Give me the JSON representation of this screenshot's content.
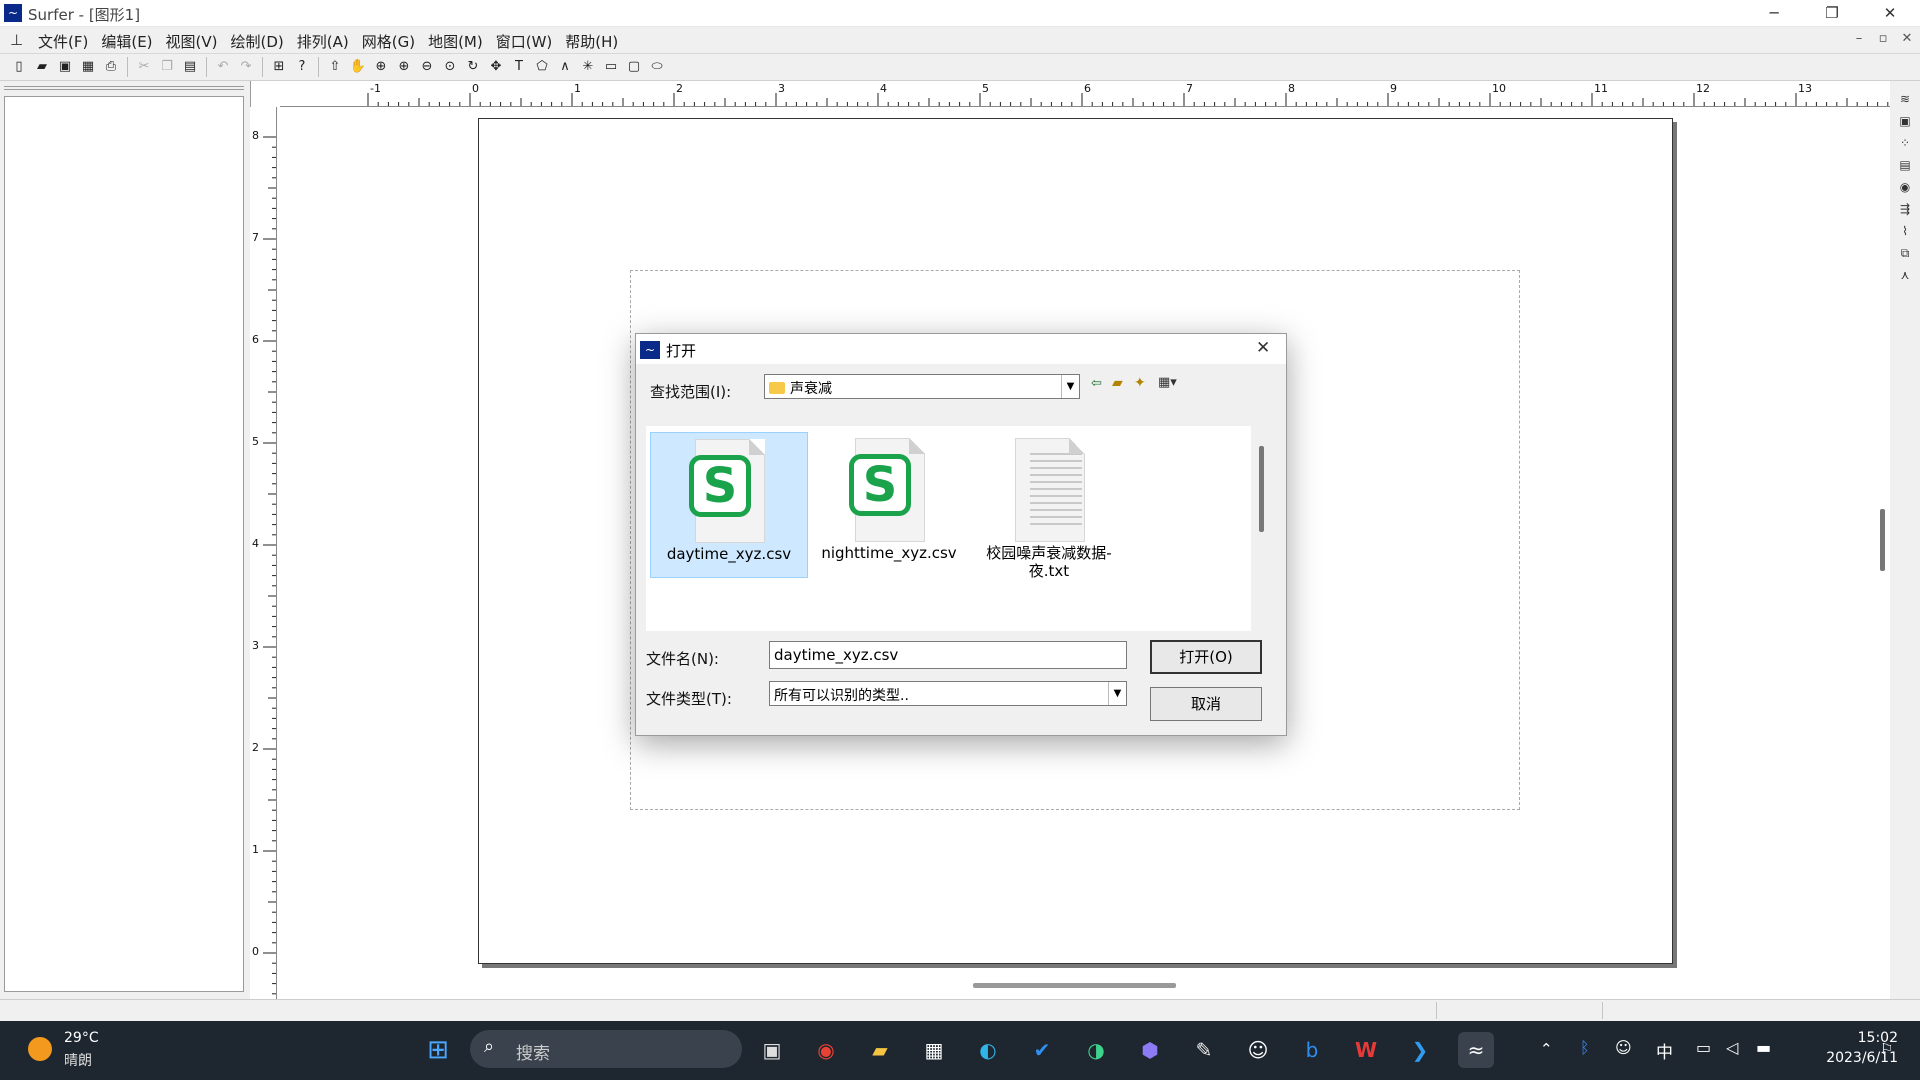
{
  "window": {
    "title": "Surfer - [图形1]",
    "minimize": "─",
    "maximize": "❐",
    "close": "✕"
  },
  "menu": [
    "文件(F)",
    "编辑(E)",
    "视图(V)",
    "绘制(D)",
    "排列(A)",
    "网格(G)",
    "地图(M)",
    "窗口(W)",
    "帮助(H)"
  ],
  "mdi": {
    "minimize": "–",
    "restore": "▫",
    "close": "✕"
  },
  "rulers": {
    "h_ticks": [
      "-1",
      "0",
      "1",
      "2",
      "3",
      "4",
      "5",
      "6",
      "7",
      "8",
      "9",
      "10",
      "11",
      "12",
      "13"
    ],
    "v_ticks": [
      "8",
      "7",
      "6",
      "5",
      "4",
      "3",
      "2",
      "1",
      "0"
    ]
  },
  "dialog": {
    "title": "打开",
    "close": "✕",
    "lookin_label": "查找范围(I):",
    "lookin_value": "声衰减",
    "files": [
      {
        "name": "daytime_xyz.csv",
        "type": "csv",
        "selected": true
      },
      {
        "name": "nighttime_xyz.csv",
        "type": "csv",
        "selected": false
      },
      {
        "name": "校园噪声衰减数据-夜.txt",
        "type": "txt",
        "selected": false
      }
    ],
    "csv_badge": "S",
    "filename_label": "文件名(N):",
    "filename_value": "daytime_xyz.csv",
    "filetype_label": "文件类型(T):",
    "filetype_value": "所有可以识别的类型..",
    "open_button": "打开(O)",
    "cancel_button": "取消"
  },
  "taskbar": {
    "weather_temp": "29°C",
    "weather_desc": "晴朗",
    "search_placeholder": "搜索",
    "time": "15:02",
    "date": "2023/6/11",
    "ime": "中"
  }
}
